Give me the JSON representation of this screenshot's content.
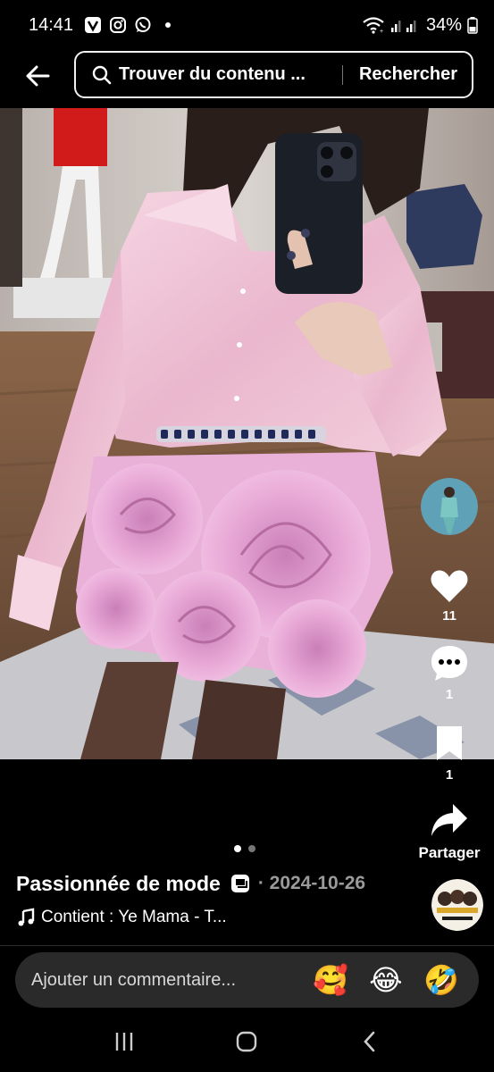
{
  "status_bar": {
    "time": "14:41",
    "battery_text": "34%",
    "icons": [
      "vpn-key-icon",
      "instagram-icon",
      "whatsapp-icon",
      "notification-dot",
      "wifi-icon",
      "signal-icon",
      "battery-icon"
    ]
  },
  "header": {
    "back_icon": "arrow-left-icon",
    "search_placeholder": "Trouver du contenu ...",
    "search_button": "Rechercher"
  },
  "actions": {
    "like_count": "11",
    "comment_count": "1",
    "bookmark_count": "1",
    "share_label": "Partager"
  },
  "carousel": {
    "page_count": 2,
    "active_page": 1
  },
  "post": {
    "author": "Passionnée de mode",
    "date": "· 2024-10-26",
    "music": "Contient : Ye Mama - T..."
  },
  "comment_bar": {
    "placeholder": "Ajouter un commentaire...",
    "emojis": [
      "🥰",
      "😂",
      "🤣"
    ]
  },
  "colors": {
    "background": "#000000",
    "skirt_pink": "#e7a8d6",
    "shirt_pink": "#f2c9dc",
    "date_gray": "#9a9a9a"
  }
}
